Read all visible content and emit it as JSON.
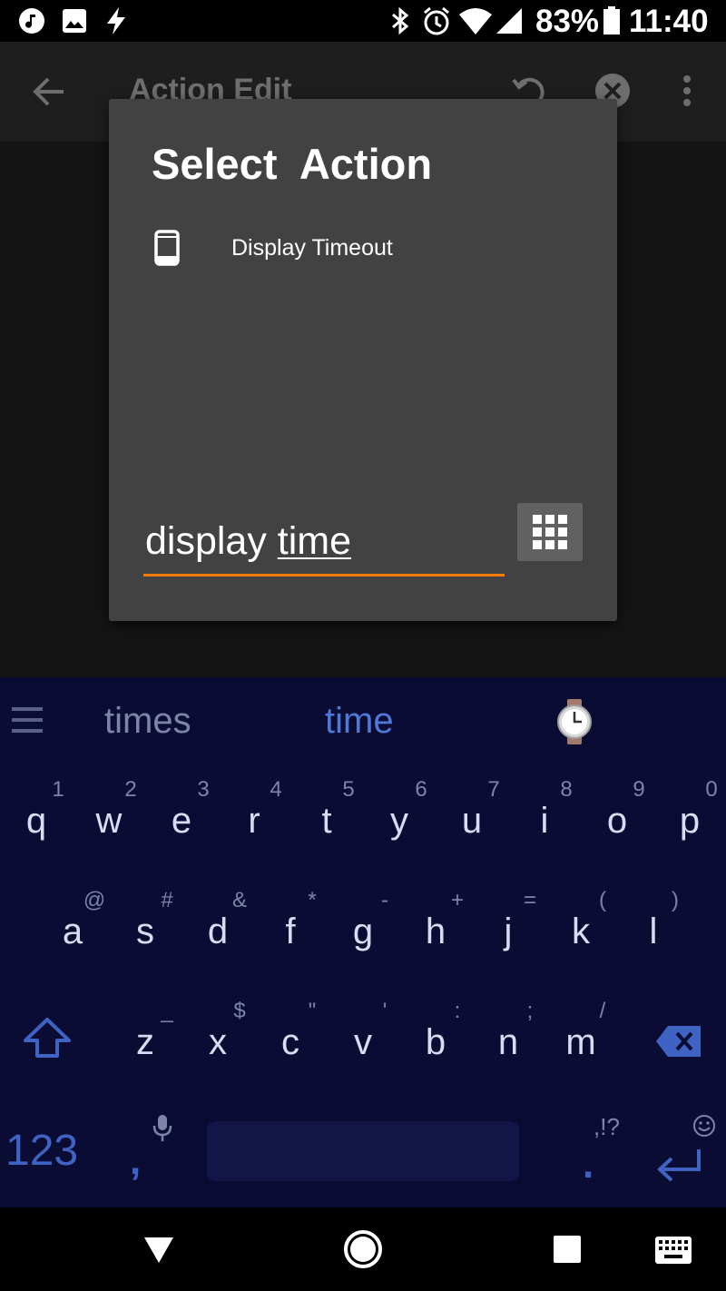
{
  "status_bar": {
    "battery": "83%",
    "time": "11:40",
    "icons": [
      "music-icon",
      "image-icon",
      "flash-icon",
      "bluetooth-icon",
      "alarm-icon",
      "wifi-icon",
      "signal-icon",
      "battery-icon"
    ]
  },
  "app_bar": {
    "title": "Action Edit",
    "icons": [
      "back-arrow-icon",
      "undo-icon",
      "close-icon",
      "overflow-menu-icon"
    ]
  },
  "dialog": {
    "title": "Select  Action",
    "results": [
      {
        "label": "Display Timeout",
        "icon": "phone-device-icon"
      }
    ],
    "search": {
      "value_prefix": "display ",
      "value_underlined": "time",
      "accent_color": "#f57c00"
    },
    "grid_button_icon": "grid-icon"
  },
  "keyboard": {
    "suggestions": [
      "times",
      "time",
      "⌚"
    ],
    "rows": [
      {
        "keys": [
          "q",
          "w",
          "e",
          "r",
          "t",
          "y",
          "u",
          "i",
          "o",
          "p"
        ],
        "hints": [
          "1",
          "2",
          "3",
          "4",
          "5",
          "6",
          "7",
          "8",
          "9",
          "0"
        ]
      },
      {
        "keys": [
          "a",
          "s",
          "d",
          "f",
          "g",
          "h",
          "j",
          "k",
          "l"
        ],
        "hints": [
          "@",
          "#",
          "&",
          "*",
          "-",
          "+",
          "=",
          "(",
          ")"
        ]
      },
      {
        "keys": [
          "z",
          "x",
          "c",
          "v",
          "b",
          "n",
          "m"
        ],
        "hints": [
          "_",
          "$",
          "\"",
          "'",
          ":",
          ";",
          "/"
        ]
      }
    ],
    "symbols_key": "123",
    "comma_key": ",",
    "period_key": ".",
    "punct_hint": ",!?",
    "accent_color": "#3f63c2",
    "background": "#0a0c33"
  },
  "nav_bar": {
    "icons": [
      "back-triangle-icon",
      "home-circle-icon",
      "recents-square-icon",
      "keyboard-icon"
    ]
  }
}
